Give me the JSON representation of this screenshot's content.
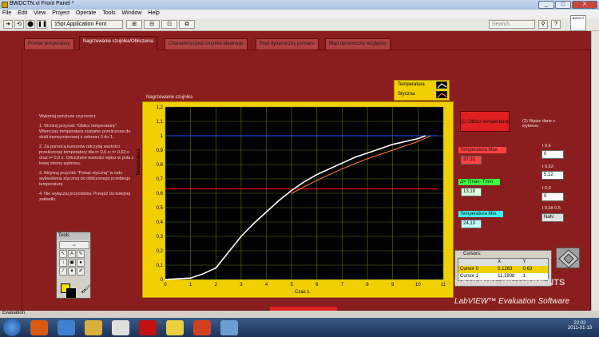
{
  "window": {
    "title": "BWDCTN.vi Front Panel *",
    "buttons": [
      "_",
      "□",
      "X"
    ]
  },
  "menu": [
    "File",
    "Edit",
    "View",
    "Project",
    "Operate",
    "Tools",
    "Window",
    "Help"
  ],
  "toolbar": {
    "font_select": "15pt Application Font",
    "search_placeholder": "Search",
    "help_badge": "BWDCT"
  },
  "tabs": [
    {
      "label": "Pomiar temperatury",
      "active": false
    },
    {
      "label": "Nagrzewanie czujnika/Obliczenia",
      "active": true
    },
    {
      "label": "Charakterystyka czujnika idealnego",
      "active": false
    },
    {
      "label": "Błąd dynamiczny pomiaru",
      "active": false
    },
    {
      "label": "Błąd dynamiczny względny",
      "active": false
    }
  ],
  "instructions": {
    "heading": "Wykonaj poniższe czynności:",
    "steps": [
      "1. Wciśnij przycisk \"Oblicz temperaturę\". Wtenczas temperatura zostanie przeliczona do skali bezwymiarowej z zakresu 0 do 1.",
      "2. Za pomocą kursorów odczytaj wartości przeliczonej temperatury dla t= 0,5 s; t= 0,63 s oraz t= 0,9 s. Odczytane wartości wpisz w pola z lewej strony wykresu.",
      "3. Aktywuj przycisk \"Pokaż styczną\" w celu wykreślenia stycznej do obliczonego przebiegu temperatury.",
      "4. Nie wyłączaj przycisków. Przejdź do kolejnej zakładki."
    ]
  },
  "tools_palette": {
    "title": "Tools",
    "tools": [
      "↔",
      "↖",
      "A",
      "✎",
      "↕",
      "▣",
      "●",
      "⁄",
      "✦",
      "✐"
    ]
  },
  "chart_data": {
    "type": "line",
    "title": "Nagrzewanie czujnika",
    "xlabel": "Czas s",
    "ylabel": "Temperatura",
    "xlim": [
      0,
      11
    ],
    "ylim": [
      0,
      1.2
    ],
    "x_ticks": [
      0,
      1,
      2,
      3,
      4,
      5,
      6,
      7,
      8,
      9,
      10,
      11
    ],
    "y_ticks": [
      "0",
      "0,1",
      "0,2",
      "0,3",
      "0,4",
      "0,5",
      "0,6",
      "0,7",
      "0,8",
      "0,9",
      "1",
      "1,1",
      "1,2"
    ],
    "grid": true,
    "legend_position": "top-right",
    "series": [
      {
        "name": "Temperatura",
        "color": "#ffffff",
        "x": [
          0,
          0.5,
          1,
          1.5,
          2,
          2.5,
          3,
          3.5,
          4,
          4.5,
          5,
          5.5,
          6,
          6.5,
          7,
          7.5,
          8,
          8.5,
          9,
          9.5,
          10,
          10.3
        ],
        "y": [
          0,
          0.005,
          0.01,
          0.04,
          0.08,
          0.19,
          0.3,
          0.39,
          0.47,
          0.55,
          0.62,
          0.68,
          0.73,
          0.77,
          0.81,
          0.85,
          0.88,
          0.91,
          0.94,
          0.96,
          0.98,
          1.0
        ]
      },
      {
        "name": "Styczna",
        "color": "#ff7040",
        "x": [
          5,
          6,
          7,
          8,
          9,
          10,
          10.5
        ],
        "y": [
          0.6,
          0.69,
          0.77,
          0.84,
          0.9,
          0.96,
          1.0
        ]
      },
      {
        "name": "",
        "color": "#2050ff",
        "x": [
          0,
          10.8
        ],
        "y": [
          1,
          1
        ]
      },
      {
        "name": "",
        "color": "#ff0000",
        "x": [
          0,
          10.8
        ],
        "y": [
          0.63,
          0.63
        ]
      }
    ]
  },
  "controls": {
    "oblicz_button": "(1) Oblicz temperaturę",
    "wpisz_label": "(2) Wpisz dane z wykresu",
    "temp_max_label": "Temperatura Max.",
    "temp_max_value": "37,31",
    "delta_label": "Δ= Tmax- Tmin",
    "delta_value": "13,18",
    "temp_min_label": "Temperatura Min.",
    "temp_min_value": "24,13",
    "t05_label": "t 0,5",
    "t05_value": "0",
    "t063_label": "t 0,63",
    "t063_value": "5,12",
    "t09_label": "t 0,9",
    "t09_value": "0",
    "ratio_label": "t 0,9/t 0,5",
    "ratio_value": "NaN"
  },
  "cursors": {
    "title": "Cursors:",
    "headers": [
      "",
      "X",
      "Y"
    ],
    "rows": [
      {
        "name": "Cursor 0",
        "x": "5,1263",
        "y": "0,63"
      },
      {
        "name": "Cursor 1",
        "x": "11,1808",
        "y": "1"
      }
    ]
  },
  "watermark": {
    "line1": "NATIONAL INSTRUMENTS",
    "line2": "LabVIEW™ Evaluation Software"
  },
  "status": {
    "mode": "Evaluation"
  },
  "taskbar": {
    "time": "22:02",
    "date": "2011-01-13"
  },
  "colors": {
    "panel": "#8a1e1e",
    "graph_frame": "#f0d000",
    "temp_max": "#ff4040",
    "delta": "#40ff40",
    "temp_min": "#40f0f0"
  }
}
